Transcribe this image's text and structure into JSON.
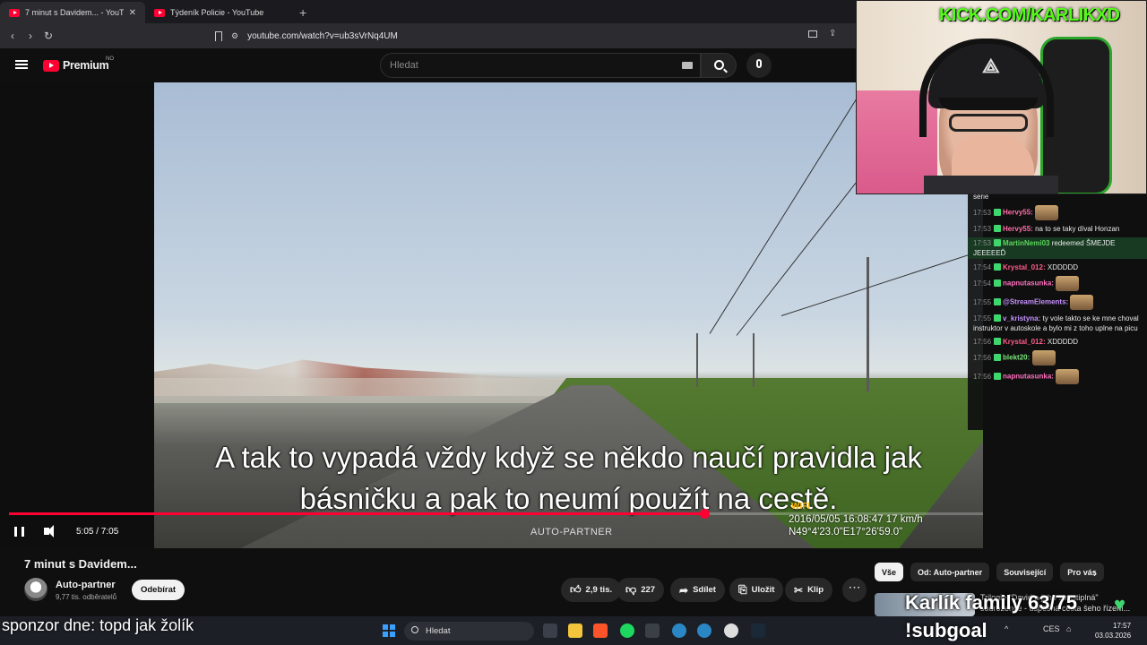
{
  "browser": {
    "tabs": [
      {
        "label": "7 minut s Davidem... - YouTube",
        "active": true
      },
      {
        "label": "Týdeník Policie - YouTube",
        "active": false
      }
    ],
    "url": "youtube.com/watch?v=ub3sVrNq4UM"
  },
  "youtube": {
    "logo_text": "Premium",
    "logo_badge": "NO",
    "search_placeholder": "Hledat"
  },
  "player": {
    "subtitle_line1": "A tak to vypadá vždy když se někdo naučí pravidla jak",
    "subtitle_line2": "básničku a pak to neumí použít na cestě.",
    "dashcam_wifi": "WIFI",
    "dashcam_line1": "2016/05/05 16:08:47  17 km/h",
    "dashcam_line2": "N49°4'23.0\"E17°26'59.0\"",
    "watermark": "AUTO-PARTNER",
    "time": "5:05 / 7:05",
    "progress_fraction": 0.714
  },
  "video": {
    "title": "7 minut s Davidem...",
    "channel": "Auto-partner",
    "subscribers": "9,77 tis. odběratelů",
    "subscribe_label": "Odebírat",
    "likes": "2,9 tis.",
    "dislikes": "227",
    "share_label": "Sdílet",
    "save_label": "Uložit",
    "clip_label": "Klip",
    "more": "⋯"
  },
  "sidebar": {
    "chips": [
      "Vše",
      "Od: Auto-partner",
      "Související",
      "Pro vás"
    ],
    "related_title": "Trilogie \"David a jeho strastiplná\" sourozence - úspěšná cesta šeho řízení..."
  },
  "stream": {
    "kick_url": "KICK.COM/KARLIKXD",
    "sponsor": "sponzor dne: topd jak žolík",
    "family": "Karlík family 63/75",
    "subgoal": "!subgoal"
  },
  "chat": {
    "messages": [
      {
        "ts": "",
        "user": "",
        "text": "série",
        "color": "#e8e8e8"
      },
      {
        "ts": "17:53",
        "user": "Hervy55:",
        "text": "",
        "color": "#ff6ea8"
      },
      {
        "ts": "17:53",
        "user": "Hervy55:",
        "text": "na to se taky díval Honzan",
        "color": "#ff6ea8"
      },
      {
        "ts": "17:53",
        "user": "MartinNemi03",
        "text": "redeemed ŠMEJDE JEEEEEĎ",
        "color": "#5cd65c"
      },
      {
        "ts": "17:54",
        "user": "Krystal_012:",
        "text": "XDDDDD",
        "color": "#ff5c8a"
      },
      {
        "ts": "17:54",
        "user": "napnutasunka:",
        "text": "",
        "color": "#ff70c0"
      },
      {
        "ts": "17:55",
        "user": "@StreamElements:",
        "text": "",
        "color": "#c792ff"
      },
      {
        "ts": "17:55",
        "user": "v_kristyna:",
        "text": "ty vole takto se ke mne choval instruktor v autoskole a bylo mi z toho uplne na picu",
        "color": "#c792ff"
      },
      {
        "ts": "17:56",
        "user": "Krystal_012:",
        "text": "XDDDDD",
        "color": "#ff5c8a"
      },
      {
        "ts": "17:56",
        "user": "blekt20:",
        "text": "",
        "color": "#7be37b"
      },
      {
        "ts": "17:56",
        "user": "napnutasunka:",
        "text": "",
        "color": "#ff70c0"
      }
    ]
  },
  "taskbar": {
    "search_label": "Hledat",
    "lang": "CES",
    "time": "17:57",
    "date": "03.03.2026"
  }
}
